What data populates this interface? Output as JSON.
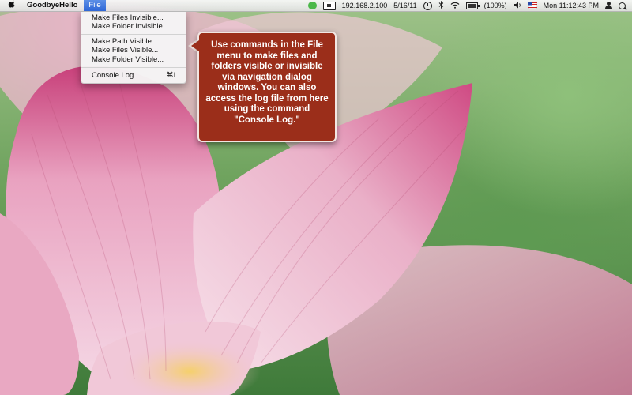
{
  "menubar": {
    "apple_icon": "apple-icon",
    "app_name": "GoodbyeHello",
    "file_menu": "File",
    "status": {
      "ip": "192.168.2.100",
      "date": "5/16/11",
      "battery": "(100%)",
      "clock": "Mon 11:12:43 PM",
      "icons": [
        "wechat-icon",
        "display-icon",
        "time-machine-icon",
        "bluetooth-icon",
        "wifi-icon",
        "battery-icon",
        "volume-icon",
        "flag-icon",
        "user-icon",
        "spotlight-icon"
      ]
    }
  },
  "file_menu": {
    "items": [
      {
        "label": "Make Files Invisible..."
      },
      {
        "label": "Make Folder Invisible..."
      },
      {
        "label": "Make Path Visible..."
      },
      {
        "label": "Make Files Visible..."
      },
      {
        "label": "Make Folder Visible..."
      },
      {
        "label": "Console Log",
        "shortcut": "⌘L"
      }
    ]
  },
  "callout": {
    "text": "Use commands in the File menu to make files and folders visible or invisible via navigation dialog windows. You can also access the log file from here using the command \"Console Log.\"",
    "background": "#9b2e1a"
  },
  "colors": {
    "menu_highlight": "#2e66d6",
    "wallpaper_green": "#5e9a52",
    "petal_pink": "#e6a6c0"
  }
}
